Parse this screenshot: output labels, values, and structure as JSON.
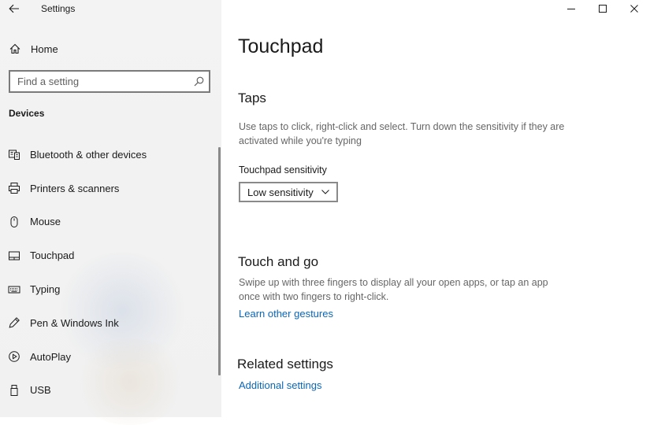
{
  "window": {
    "title": "Settings",
    "controls": [
      "minimize-icon",
      "maximize-icon",
      "close-icon"
    ]
  },
  "sidebar": {
    "back_icon": "back-arrow-icon",
    "home": {
      "label": "Home",
      "icon": "home-icon"
    },
    "search": {
      "placeholder": "Find a setting",
      "value": "",
      "icon": "search-icon"
    },
    "section_label": "Devices",
    "items": [
      {
        "label": "Bluetooth & other devices",
        "icon": "bluetooth-devices-icon"
      },
      {
        "label": "Printers & scanners",
        "icon": "printer-icon"
      },
      {
        "label": "Mouse",
        "icon": "mouse-icon"
      },
      {
        "label": "Touchpad",
        "icon": "touchpad-icon",
        "selected": true
      },
      {
        "label": "Typing",
        "icon": "keyboard-icon"
      },
      {
        "label": "Pen & Windows Ink",
        "icon": "pen-icon"
      },
      {
        "label": "AutoPlay",
        "icon": "autoplay-icon"
      },
      {
        "label": "USB",
        "icon": "usb-icon"
      }
    ]
  },
  "content": {
    "page_title": "Touchpad",
    "taps": {
      "heading": "Taps",
      "description": "Use taps to click, right-click and select. Turn down the sensitivity if they are activated while you're typing",
      "sensitivity_label": "Touchpad sensitivity",
      "sensitivity_value": "Low sensitivity"
    },
    "touch_and_go": {
      "heading": "Touch and go",
      "description": "Swipe up with three fingers to display all your open apps, or tap an app once with two fingers to right-click.",
      "link": "Learn other gestures"
    },
    "related": {
      "heading": "Related settings",
      "link": "Additional settings"
    }
  },
  "colors": {
    "sidebar_bg": "#f2f2f2",
    "link": "#0a66b7",
    "description_text": "#666666",
    "border": "#7a7a7a"
  }
}
